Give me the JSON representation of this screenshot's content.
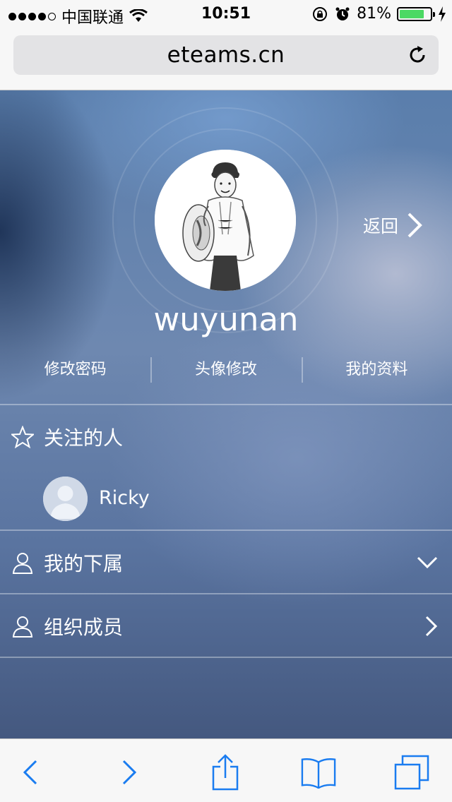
{
  "status_bar": {
    "carrier": "中国联通",
    "time": "10:51",
    "battery_percent": "81%",
    "battery_level": 0.81,
    "battery_color": "#4cd964"
  },
  "browser": {
    "url": "eteams.cn",
    "reload_icon": "reload-icon"
  },
  "profile": {
    "username": "wuyunan",
    "back_label": "返回",
    "actions": [
      "修改密码",
      "头像修改",
      "我的资料"
    ]
  },
  "sections": {
    "following": {
      "label": "关注的人",
      "icon": "star-icon"
    },
    "subordinates": {
      "label": "我的下属",
      "icon": "person-icon",
      "right_icon": "chevron-down-icon"
    },
    "org_members": {
      "label": "组织成员",
      "icon": "person-icon",
      "right_icon": "chevron-right-icon"
    }
  },
  "following_list": [
    {
      "name": "Ricky"
    }
  ],
  "toolbar": {
    "items": [
      "back-icon",
      "forward-icon",
      "share-icon",
      "bookmarks-icon",
      "tabs-icon"
    ],
    "accent": "#1a7cf0"
  }
}
